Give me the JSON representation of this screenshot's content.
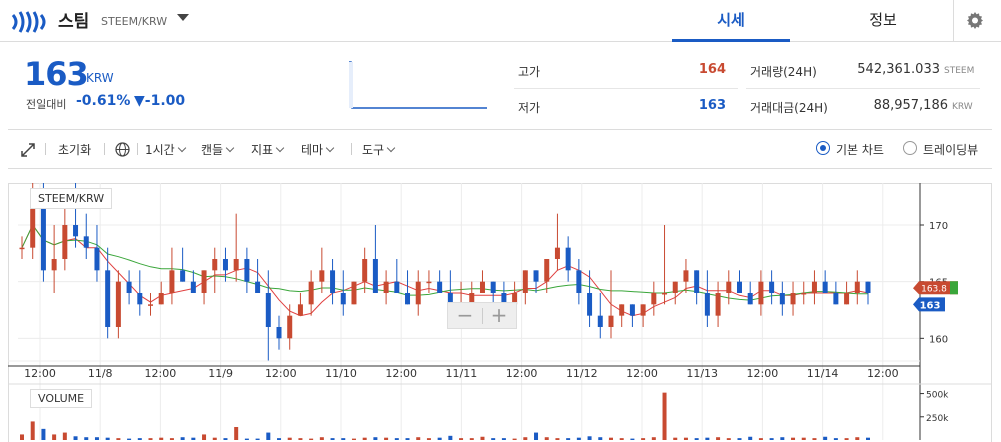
{
  "header": {
    "coin_name": "스팀",
    "pair": "STEEM/KRW",
    "tabs": [
      {
        "label": "시세",
        "active": true
      },
      {
        "label": "정보",
        "active": false
      }
    ],
    "icons": {
      "logo": "steem-logo-icon",
      "settings": "gear-icon",
      "dropdown": "caret-down-icon"
    },
    "colors": {
      "accent": "#1a5bc4",
      "up": "#c84a31",
      "down": "#1a5bc4"
    }
  },
  "summary": {
    "price": "163",
    "unit": "KRW",
    "change_label": "전일대비",
    "change_pct": "-0.61%",
    "change_abs": "▼-1.00",
    "high_label": "고가",
    "high_value": "164",
    "low_label": "저가",
    "low_value": "163",
    "volume_label": "거래량(24H)",
    "volume_value": "542,361.033",
    "volume_unit": "STEEM",
    "amount_label": "거래대금(24H)",
    "amount_value": "88,957,186",
    "amount_unit": "KRW"
  },
  "toolbar": {
    "reset": "초기화",
    "interval": "1시간",
    "candle": "캔들",
    "indicator": "지표",
    "theme": "테마",
    "tools": "도구",
    "basic_chart": "기본 차트",
    "trading_view": "트레이딩뷰",
    "selected_view": "기본 차트",
    "icons": {
      "expand": "expand-icon",
      "globe": "globe-icon"
    }
  },
  "chart_data": {
    "type": "candlestick",
    "series_label": "STEEM/KRW",
    "volume_label": "VOLUME",
    "price_axis_ticks": [
      "170",
      "165",
      "160"
    ],
    "volume_axis_ticks": [
      "500k",
      "250k"
    ],
    "time_axis_labels": [
      "12:00",
      "11/8",
      "12:00",
      "11/9",
      "12:00",
      "11/10",
      "12:00",
      "11/11",
      "12:00",
      "11/12",
      "12:00",
      "11/13",
      "12:00",
      "11/14",
      "12:00"
    ],
    "current_price_tag": "163",
    "ma_tag": "163.8",
    "ylim": [
      158,
      173
    ],
    "candles": [
      [
        168,
        169,
        167,
        168
      ],
      [
        168,
        175,
        167,
        172
      ],
      [
        172,
        174,
        165,
        166
      ],
      [
        166,
        170,
        164,
        167
      ],
      [
        167,
        173,
        166,
        170
      ],
      [
        170,
        174,
        168,
        169
      ],
      [
        169,
        171,
        167,
        168
      ],
      [
        168,
        170,
        165,
        166
      ],
      [
        166,
        168,
        160,
        161
      ],
      [
        161,
        166,
        160,
        165
      ],
      [
        165,
        166,
        163,
        164
      ],
      [
        164,
        166,
        162,
        163
      ],
      [
        163,
        164,
        162,
        163
      ],
      [
        163,
        165,
        163,
        164
      ],
      [
        164,
        168,
        163,
        166
      ],
      [
        166,
        168,
        165,
        165
      ],
      [
        165,
        166,
        164,
        164
      ],
      [
        164,
        166,
        163,
        166
      ],
      [
        166,
        168,
        164,
        167
      ],
      [
        167,
        168,
        165,
        166
      ],
      [
        166,
        171,
        165,
        167
      ],
      [
        167,
        168,
        164,
        165
      ],
      [
        165,
        167,
        164,
        164
      ],
      [
        164,
        166,
        158,
        161
      ],
      [
        161,
        162,
        159,
        160
      ],
      [
        160,
        163,
        159,
        162
      ],
      [
        162,
        164,
        162,
        163
      ],
      [
        163,
        166,
        162,
        165
      ],
      [
        165,
        168,
        164,
        166
      ],
      [
        166,
        167,
        163,
        164
      ],
      [
        164,
        166,
        162,
        163
      ],
      [
        163,
        165,
        163,
        165
      ],
      [
        165,
        168,
        164,
        167
      ],
      [
        167,
        170,
        165,
        164
      ],
      [
        164,
        166,
        163,
        165
      ],
      [
        165,
        167,
        164,
        164
      ],
      [
        164,
        166,
        163,
        163
      ],
      [
        163,
        166,
        162,
        165
      ],
      [
        165,
        166,
        164,
        165
      ],
      [
        165,
        166,
        164,
        164
      ],
      [
        164,
        166,
        163,
        163
      ],
      [
        163,
        165,
        162,
        163
      ],
      [
        163,
        165,
        163,
        164
      ],
      [
        164,
        166,
        164,
        165
      ],
      [
        165,
        165,
        163,
        164
      ],
      [
        164,
        165,
        162,
        163
      ],
      [
        163,
        165,
        162,
        164
      ],
      [
        164,
        166,
        163,
        166
      ],
      [
        166,
        166,
        164,
        165
      ],
      [
        165,
        167,
        164,
        167
      ],
      [
        167,
        171,
        166,
        168
      ],
      [
        168,
        169,
        165,
        166
      ],
      [
        166,
        167,
        163,
        164
      ],
      [
        164,
        166,
        161,
        162
      ],
      [
        162,
        164,
        160,
        161
      ],
      [
        161,
        166,
        160,
        162
      ],
      [
        162,
        163,
        161,
        163
      ],
      [
        163,
        163,
        161,
        162
      ],
      [
        162,
        163,
        161,
        163
      ],
      [
        163,
        165,
        162,
        164
      ],
      [
        164,
        170,
        163,
        164
      ],
      [
        164,
        165,
        163,
        165
      ],
      [
        165,
        167,
        164,
        166
      ],
      [
        166,
        166,
        163,
        164
      ],
      [
        164,
        166,
        161,
        162
      ],
      [
        162,
        165,
        161,
        164
      ],
      [
        164,
        166,
        163,
        165
      ],
      [
        165,
        166,
        164,
        164
      ],
      [
        164,
        165,
        163,
        163
      ],
      [
        163,
        166,
        162,
        165
      ],
      [
        165,
        166,
        163,
        164
      ],
      [
        164,
        165,
        162,
        163
      ],
      [
        163,
        165,
        162,
        164
      ],
      [
        164,
        165,
        163,
        164
      ],
      [
        164,
        166,
        163,
        165
      ],
      [
        165,
        166,
        164,
        164
      ],
      [
        164,
        165,
        163,
        163
      ],
      [
        163,
        165,
        163,
        164
      ],
      [
        164,
        166,
        163,
        165
      ],
      [
        165,
        165,
        163,
        164
      ]
    ],
    "volumes": [
      60,
      200,
      120,
      60,
      80,
      40,
      30,
      30,
      25,
      20,
      15,
      20,
      20,
      25,
      20,
      30,
      25,
      60,
      25,
      20,
      140,
      15,
      15,
      80,
      20,
      25,
      20,
      15,
      30,
      20,
      20,
      15,
      25,
      30,
      25,
      20,
      20,
      30,
      20,
      25,
      45,
      20,
      20,
      35,
      20,
      20,
      15,
      30,
      80,
      30,
      20,
      20,
      25,
      40,
      30,
      25,
      20,
      15,
      20,
      30,
      510,
      25,
      25,
      20,
      25,
      30,
      20,
      20,
      35,
      20,
      20,
      30,
      25,
      25,
      20,
      35,
      20,
      20,
      30,
      25
    ]
  }
}
